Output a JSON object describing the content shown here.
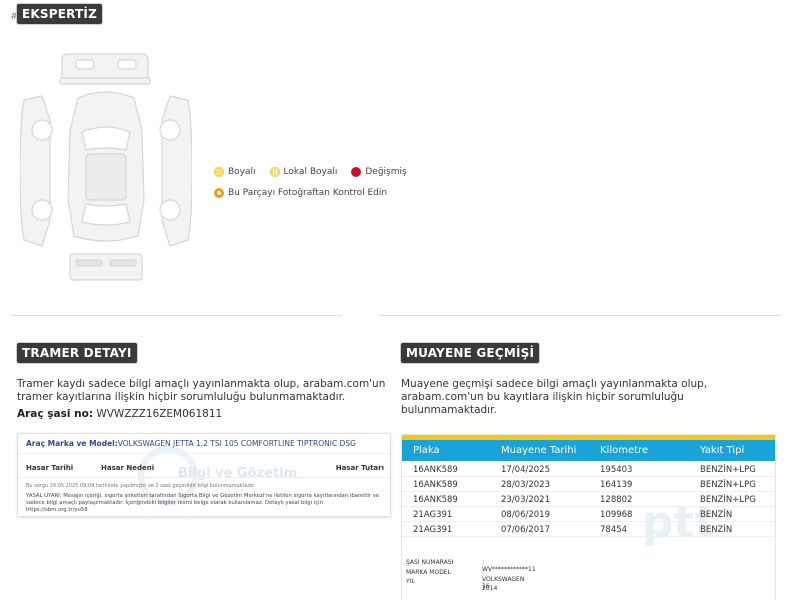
{
  "hash_symbol": "#",
  "ekspertiz": {
    "title": "EKSPERTİZ",
    "legend": [
      {
        "label": "Boyalı",
        "color": "#f6e06a"
      },
      {
        "label": "Lokal Boyalı",
        "color": "#f6e06a"
      },
      {
        "label": "Değişmiş",
        "color": "#c8102e"
      }
    ],
    "photo_check_label": "Bu Parçayı Fotoğraftan Kontrol Edin",
    "photo_check_color": "#f39c12"
  },
  "tramer": {
    "title": "TRAMER DETAYI",
    "disclaimer": "Tramer kaydı sadece bilgi amaçlı yayınlanmakta olup, arabam.com'un tramer kayıtlarına ilişkin hiçbir sorumluluğu bulunmamaktadır.",
    "chassis_label": "Araç şasi no:",
    "chassis_value": "WVWZZZ16ZEM061811",
    "card": {
      "model_label": "Araç Marka ve Model:",
      "model_value": "VOLKSWAGEN JETTA 1.2 TSI 105 COMFORTLINE TIPTRONIC DSG",
      "watermark": "Bilgi ve Gözetim",
      "headers": [
        "Hasar Tarihi",
        "Hasar Nedeni",
        "Hasar Tutarı"
      ],
      "query_note": "Bu sorgu 29.05.2025 09:09 tarihinde yapılmıştır ve 2 saat geçerlidir bilgi bulunmamaktadır.",
      "legal": "YASAL UYARI: Mesajın içeriği, sigorta şirketleri tarafından Sigorta Bilgi ve Gözetim Merkezi'ne iletilen sigorta kayıtlarından ibarettir ve sadece bilgi amaçlı paylaşılmaktadır. İçeriğindeki bilgiler resmi belge olarak kullanılamaz. Detaylı yasal bilgi için https://sbm.org.tr/yu58"
    }
  },
  "muayene": {
    "title": "MUAYENE GEÇMİŞİ",
    "disclaimer": "Muayene geçmişi sadece bilgi amaçlı yayınlanmakta olup, arabam.com'un bu kayıtlara ilişkin hiçbir sorumluluğu bulunmamaktadır.",
    "watermark": "ptt",
    "columns": [
      "Plaka",
      "Muayene Tarihi",
      "Kilometre",
      "Yakıt Tipi"
    ],
    "rows": [
      [
        "16ANK589",
        "17/04/2025",
        "195403",
        "BENZİN+LPG"
      ],
      [
        "16ANK589",
        "28/03/2023",
        "164139",
        "BENZİN+LPG"
      ],
      [
        "16ANK589",
        "23/03/2021",
        "128802",
        "BENZİN+LPG"
      ],
      [
        "21AG391",
        "08/06/2019",
        "109968",
        "BENZİN"
      ],
      [
        "21AG391",
        "07/06/2017",
        "78454",
        "BENZİN"
      ]
    ],
    "info": [
      {
        "key": "ŞASİ NUMARASI",
        "value": ": WV************11"
      },
      {
        "key": "MARKA MODEL",
        "value": ": VOLKSWAGEN 16"
      },
      {
        "key": "YIL",
        "value": ": 2014"
      }
    ],
    "colors": {
      "header": "#1aa3d9",
      "topbar": "#f5c518"
    }
  }
}
